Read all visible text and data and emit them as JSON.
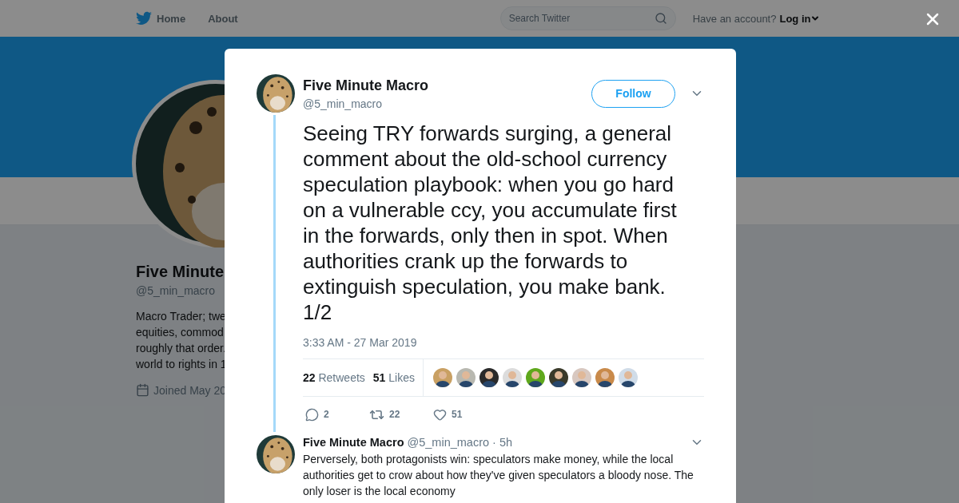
{
  "top_nav": {
    "items": [
      {
        "label": "Home",
        "kind": "logo"
      },
      {
        "label": "About",
        "kind": "plain"
      }
    ],
    "search": {
      "placeholder": "Search Twitter"
    },
    "account_prompt": "Have an account?",
    "login": "Log in"
  },
  "profile": {
    "name": "Five Minute",
    "handle": "@5_min_macro",
    "bio_lines": [
      "Macro Trader; twe",
      "equities, commod",
      "roughly that order.",
      "world to rights in 1"
    ],
    "joined": "Joined May 20"
  },
  "tweet": {
    "author": "Five Minute Macro",
    "handle": "@5_min_macro",
    "follow": "Follow",
    "text": "Seeing TRY forwards surging, a general comment about the old-school currency speculation playbook: when you go hard on a vulnerable ccy, you accumulate first in the forwards, only then in spot. When authorities crank up the forwards to extinguish speculation, you make bank. 1/2",
    "timestamp": "3:33 AM - 27 Mar 2019",
    "stats": [
      {
        "count": "22",
        "label": "Retweets"
      },
      {
        "count": "51",
        "label": "Likes"
      }
    ],
    "actions": [
      {
        "kind": "reply",
        "count": "2"
      },
      {
        "kind": "retweet",
        "count": "22"
      },
      {
        "kind": "like",
        "count": "51"
      }
    ]
  },
  "reply": {
    "author": "Five Minute Macro",
    "handle": "@5_min_macro",
    "time": "· 5h",
    "text": "Perversely, both protagonists win: speculators make money, while the local authorities get to crow about how they've given speculators a bloody nose. The only loser is the local economy"
  }
}
